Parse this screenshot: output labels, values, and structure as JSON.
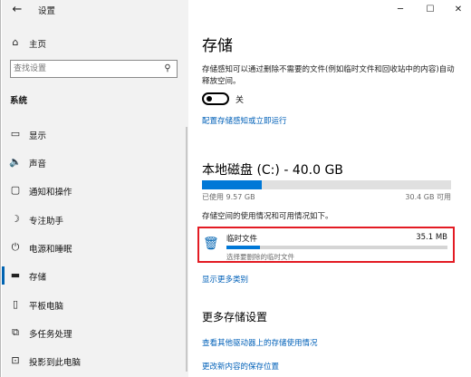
{
  "titlebar": {
    "back_icon": "back-arrow-icon",
    "title": "设置",
    "minimize": "─",
    "maximize": "☐",
    "close": "✕"
  },
  "sidebar": {
    "home": {
      "label": "主页",
      "icon": "home-icon"
    },
    "search": {
      "placeholder": "查找设置",
      "icon": "search-icon"
    },
    "section": "系统",
    "items": [
      {
        "label": "显示",
        "icon": "monitor-icon"
      },
      {
        "label": "声音",
        "icon": "speaker-icon"
      },
      {
        "label": "通知和操作",
        "icon": "notification-icon"
      },
      {
        "label": "专注助手",
        "icon": "moon-icon"
      },
      {
        "label": "电源和睡眠",
        "icon": "power-icon"
      },
      {
        "label": "存储",
        "icon": "storage-icon",
        "selected": true
      },
      {
        "label": "平板电脑",
        "icon": "tablet-icon"
      },
      {
        "label": "多任务处理",
        "icon": "multitask-icon"
      },
      {
        "label": "投影到此电脑",
        "icon": "projector-icon"
      }
    ]
  },
  "main": {
    "title": "存储",
    "description": "存储感知可以通过删除不需要的文件(例如临时文件和回收站中的内容)自动释放空间。",
    "toggle": {
      "state": "关",
      "on": false
    },
    "configure_link": "配置存储感知或立即运行",
    "disk": {
      "title": "本地磁盘 (C:) - 40.0 GB",
      "used": "已使用 9.57 GB",
      "free": "30.4 GB 可用",
      "used_fraction": 0.24
    },
    "usage_text": "存储空间的使用情况和可用情况如下。",
    "temp_files": {
      "label": "临时文件",
      "size": "35.1 MB",
      "hint": "选择要删除的临时文件",
      "icon": "trash-icon",
      "fraction": 0.15,
      "highlight": "#e31b23"
    },
    "more_categories": "显示更多类别",
    "more_settings_title": "更多存储设置",
    "link_other_drives": "查看其他驱动器上的存储使用情况",
    "link_change_save": "更改新内容的保存位置"
  },
  "colors": {
    "accent": "#0078d7",
    "link": "#0060b8",
    "highlight": "#e31b23"
  }
}
